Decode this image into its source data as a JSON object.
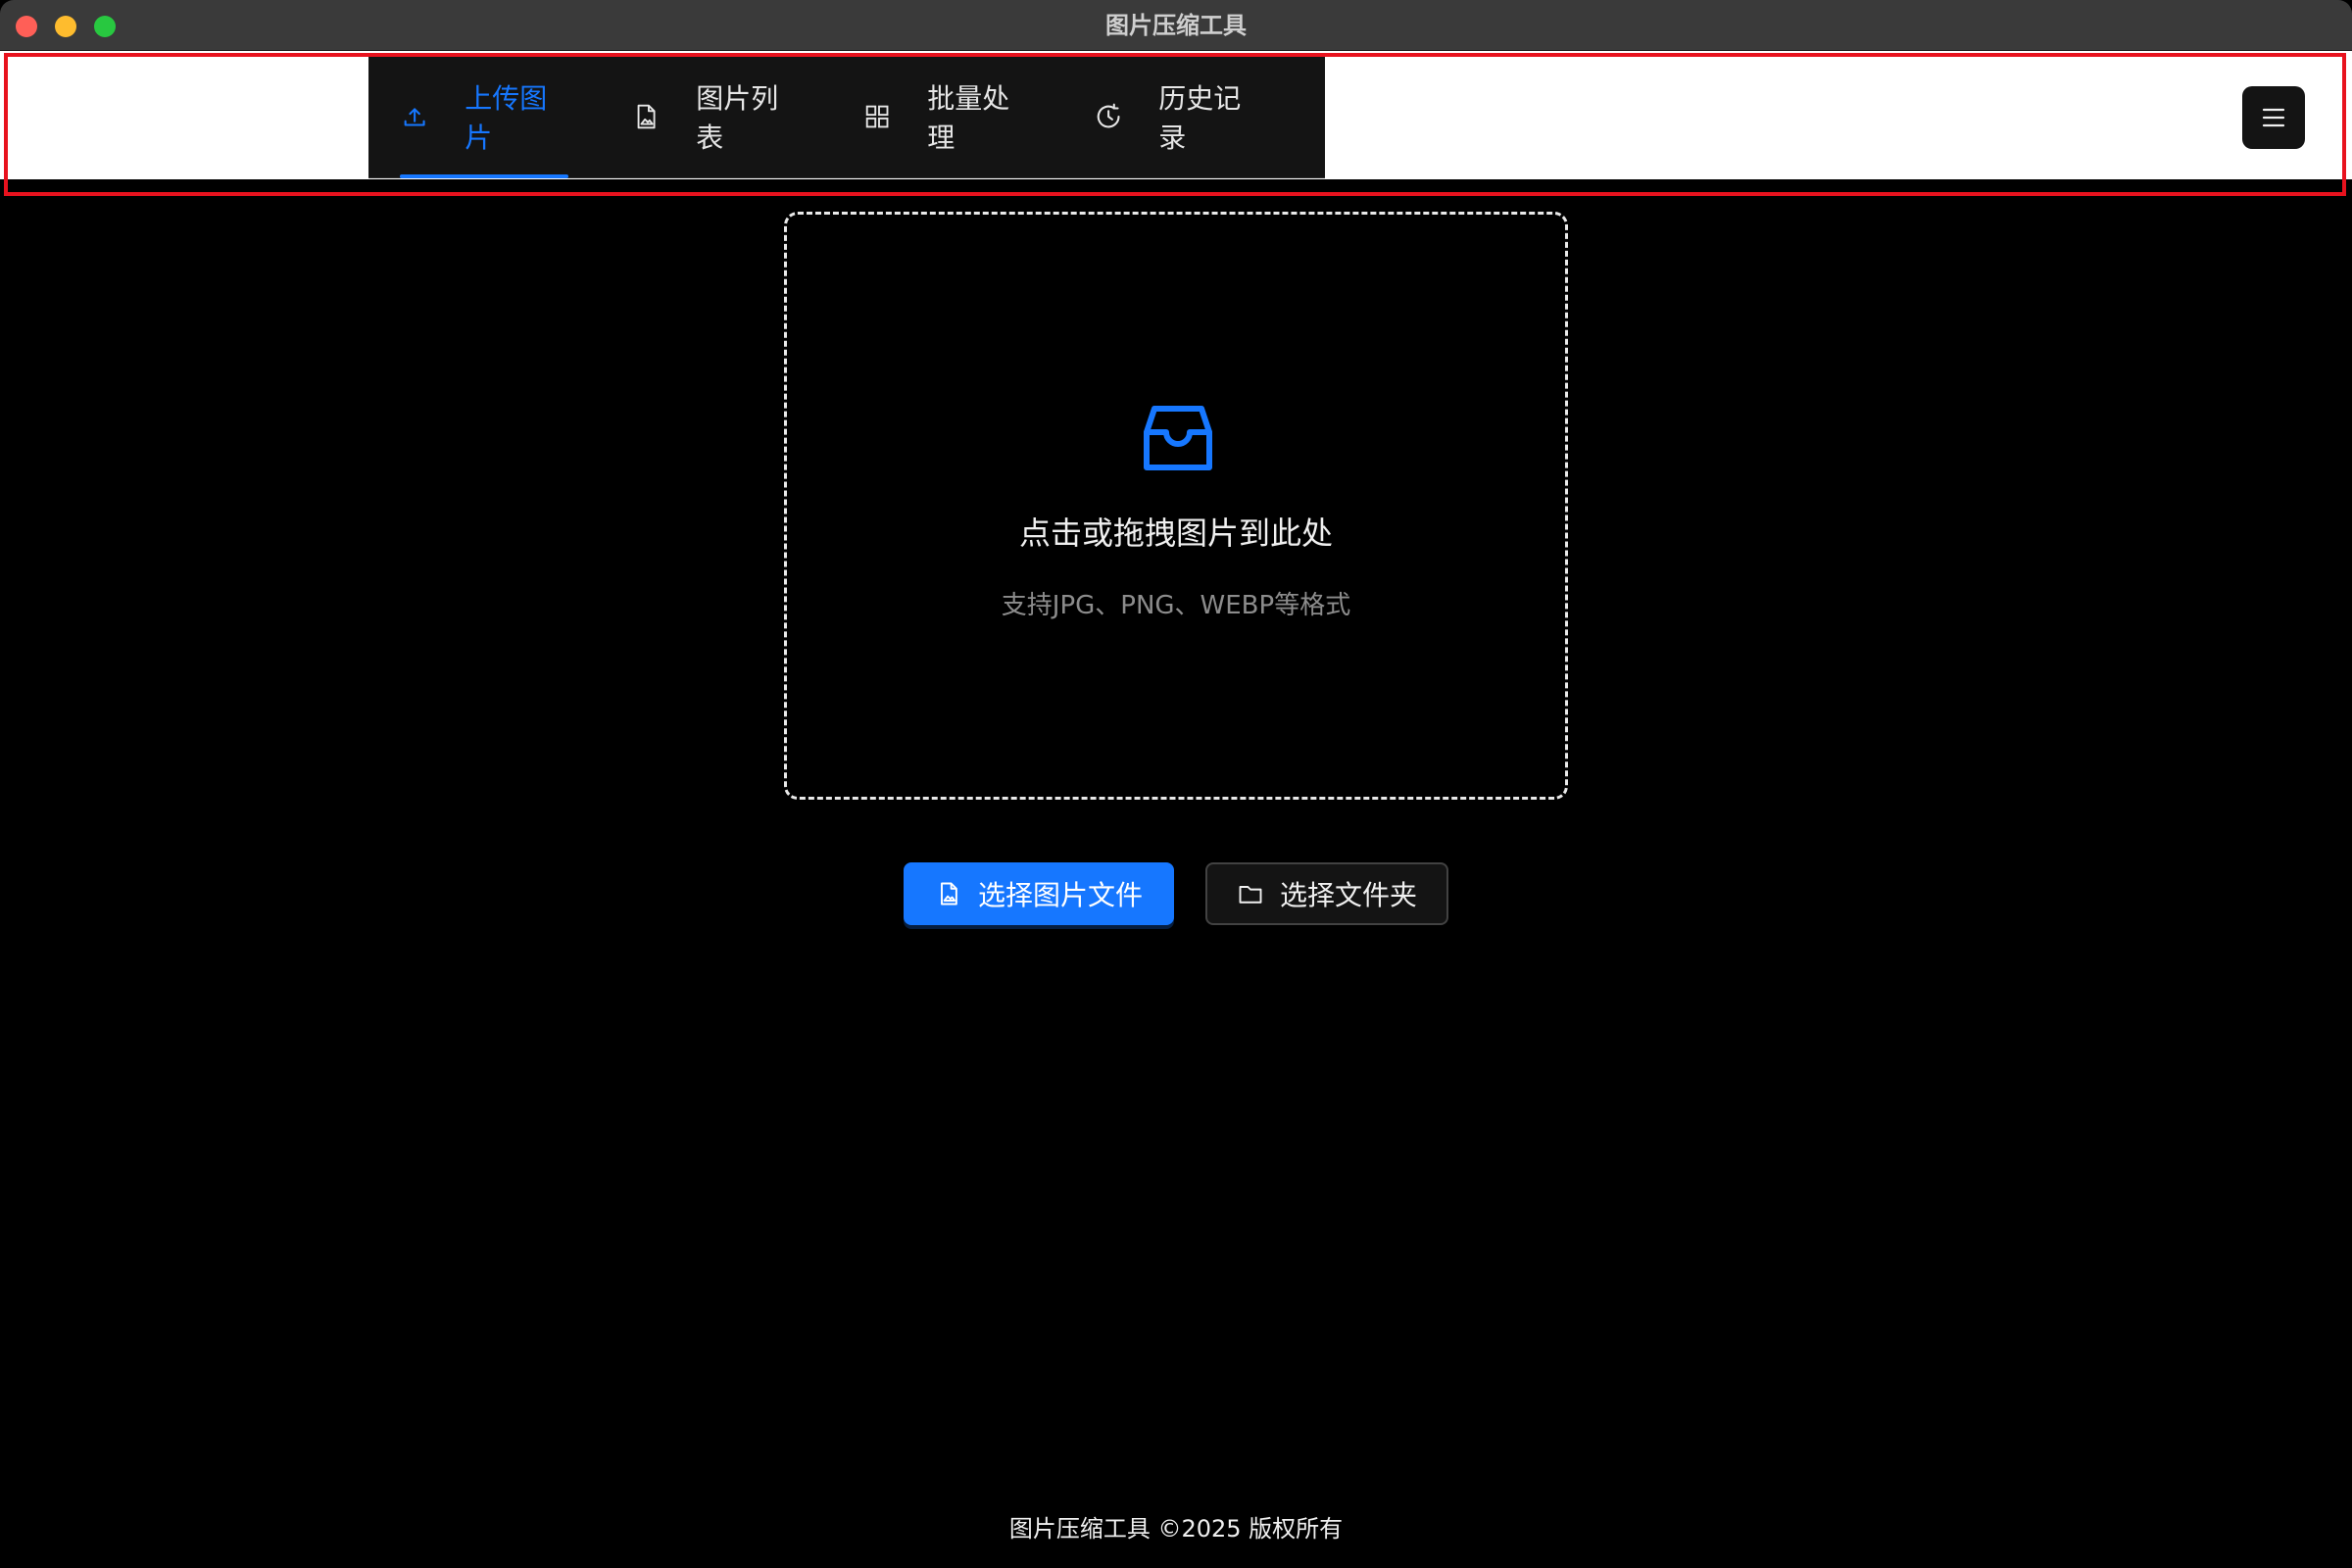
{
  "window": {
    "title": "图片压缩工具"
  },
  "nav": {
    "items": [
      {
        "label": "上传图片",
        "icon": "upload-icon",
        "active": true
      },
      {
        "label": "图片列表",
        "icon": "image-file-icon",
        "active": false
      },
      {
        "label": "批量处理",
        "icon": "grid-icon",
        "active": false
      },
      {
        "label": "历史记录",
        "icon": "history-icon",
        "active": false
      }
    ],
    "menu_icon": "hamburger-menu-icon"
  },
  "upload": {
    "icon": "inbox-icon",
    "title": "点击或拖拽图片到此处",
    "hint": "支持JPG、PNG、WEBP等格式"
  },
  "actions": {
    "select_files_label": "选择图片文件",
    "select_folder_label": "选择文件夹"
  },
  "footer": {
    "text": "图片压缩工具 ©2025 版权所有"
  },
  "colors": {
    "accent": "#1677ff",
    "background": "#000000",
    "highlight_border": "#e8121e"
  }
}
